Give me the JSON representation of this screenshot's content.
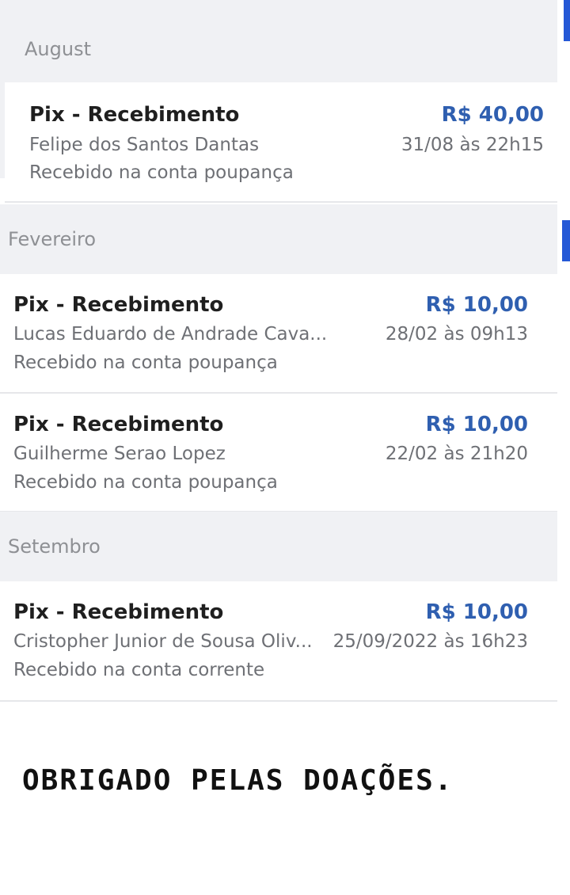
{
  "sections": [
    {
      "header": "August",
      "transactions": [
        {
          "title": "Pix - Recebimento",
          "amount": "R$ 40,00",
          "name": "Felipe dos Santos Dantas",
          "date": "31/08 às 22h15",
          "account": "Recebido na conta poupança"
        }
      ]
    },
    {
      "header": "Fevereiro",
      "transactions": [
        {
          "title": "Pix - Recebimento",
          "amount": "R$ 10,00",
          "name": "Lucas Eduardo de Andrade Cava...",
          "date": "28/02 às 09h13",
          "account": "Recebido na conta poupança"
        },
        {
          "title": "Pix - Recebimento",
          "amount": "R$ 10,00",
          "name": "Guilherme Serao Lopez",
          "date": "22/02 às 21h20",
          "account": "Recebido na conta poupança"
        }
      ]
    },
    {
      "header": "Setembro",
      "transactions": [
        {
          "title": "Pix - Recebimento",
          "amount": "R$ 10,00",
          "name": "Cristopher Junior de Sousa Oliv...",
          "date": "25/09/2022 às 16h23",
          "account": "Recebido na conta corrente"
        }
      ]
    }
  ],
  "footer_note": "Obrigado pelas doações.",
  "colors": {
    "amount": "#2f5fb0",
    "header_bg": "#f0f1f4",
    "accent": "#2458d6"
  }
}
